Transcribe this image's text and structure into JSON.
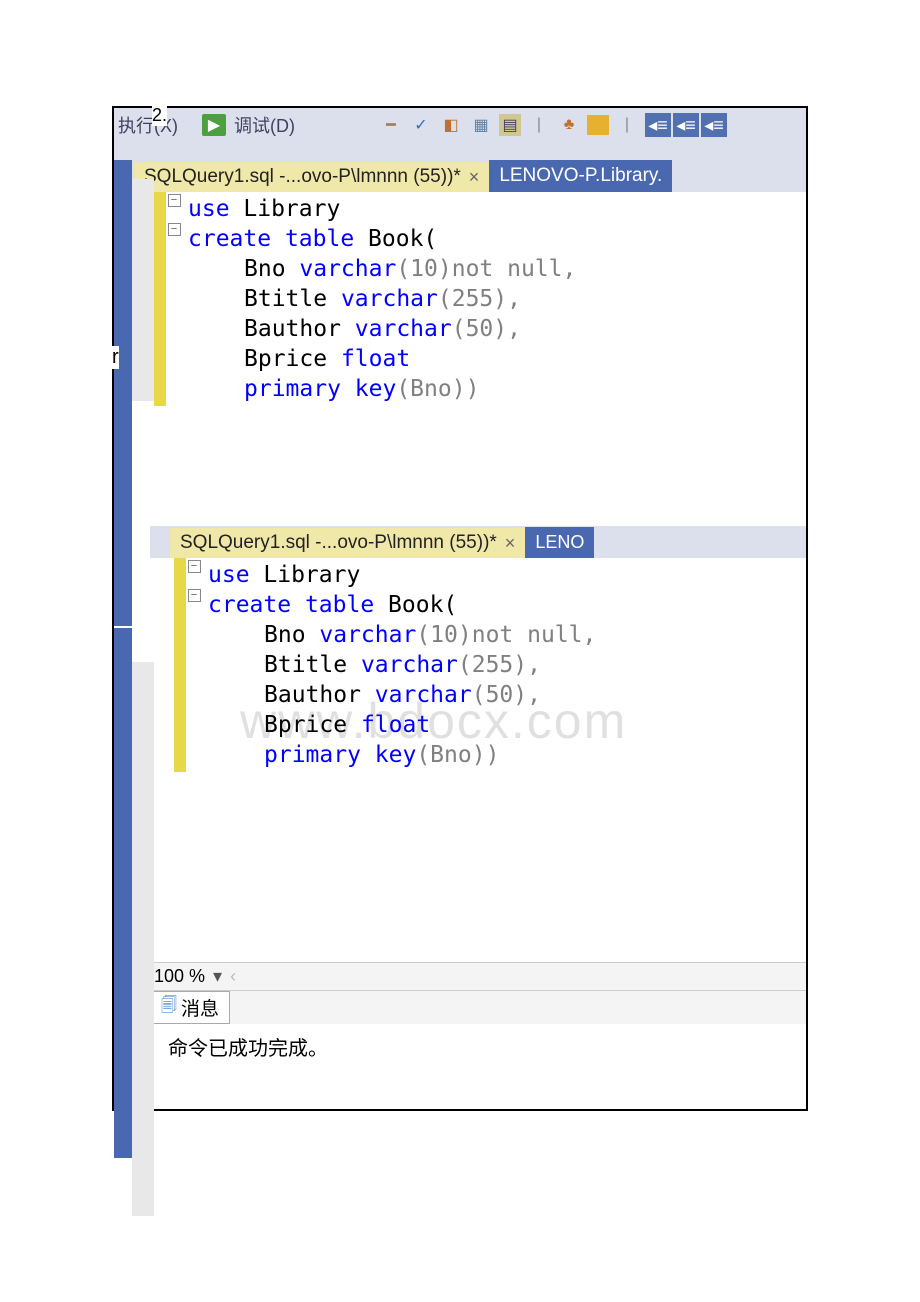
{
  "number": "2.",
  "toolbar": {
    "menu1": "执行(X)",
    "menu2": "调试(D)"
  },
  "panel1": {
    "tab_active": "SQLQuery1.sql -...ovo-P\\lmnnn (55))*",
    "tab_close": "×",
    "tab_inactive": "LENOVO-P.Library.",
    "code": {
      "line1_kw": "use",
      "line1_rest": " Library",
      "line2_kw": "create",
      "line2_kw2": " table",
      "line2_rest": " Book(",
      "line3_id": "Bno ",
      "line3_kw": "varchar",
      "line3_paren": "(10)",
      "line3_not": "not",
      "line3_null": " null,",
      "line4_id": "Btitle ",
      "line4_kw": "varchar",
      "line4_paren": "(255),",
      "line5_id": "Bauthor ",
      "line5_kw": "varchar",
      "line5_paren": "(50),",
      "line6_id": "Bprice ",
      "line6_kw": "float",
      "line7_kw": "primary",
      "line7_kw2": " key",
      "line7_paren": "(Bno))"
    }
  },
  "r_label": "r",
  "panel2": {
    "tab_active": "SQLQuery1.sql -...ovo-P\\lmnnn (55))*",
    "tab_close": "×",
    "tab_inactive": "LENO"
  },
  "zoom": {
    "value": "100 %",
    "arrow": "▾",
    "scroll": "‹"
  },
  "messages": {
    "tab_label": "消息",
    "content": "命令已成功完成。"
  },
  "watermark": "www.bdocx.com"
}
